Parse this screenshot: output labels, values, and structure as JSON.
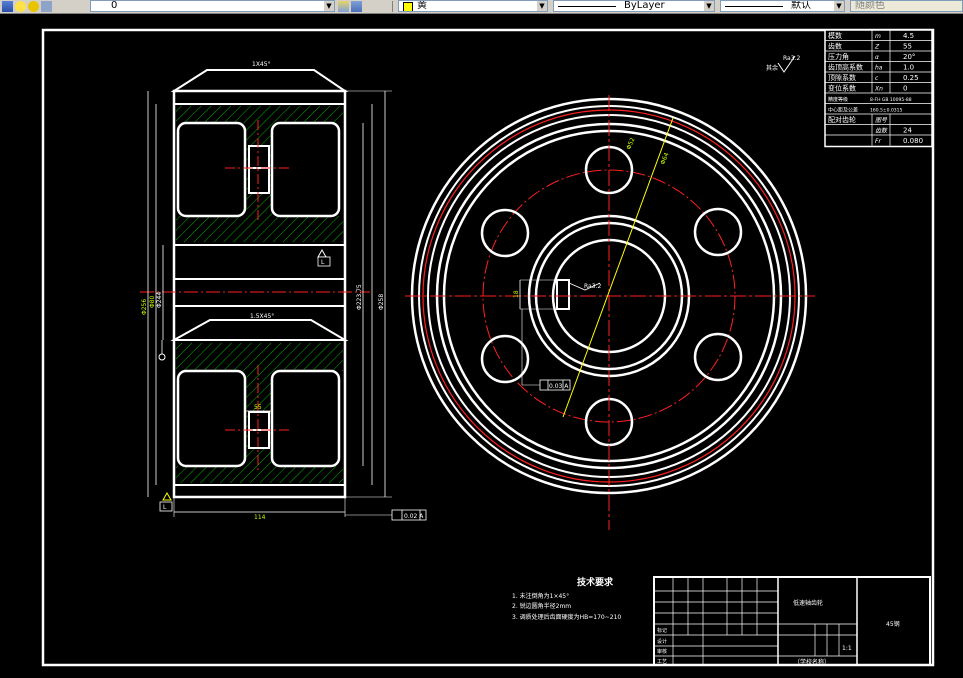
{
  "toolbar": {
    "layer_value": "0",
    "color_value": "黄",
    "linetype_value": "ByLayer",
    "lineweight_value": "默认",
    "plotstyle_value": "随颜色"
  },
  "drawing": {
    "section_top_label": "1X45°",
    "section_mid_label": "1.5X45°",
    "datum_label": "L",
    "roughness_label": "Ra3.2",
    "hub_width_label": "55",
    "bottom_width": "114",
    "tolerance_frame": "0.02 A",
    "keyway_dim": "18",
    "circle_dim_a": "Φ52",
    "circle_dim_b": "Φ64",
    "runout_frame": "0.03 A",
    "surface_mark": "其余",
    "left_dims": [
      "Φ256",
      "Φ80",
      "Φ244",
      "Φ240"
    ],
    "right_dims": [
      "Φ223.75",
      "Φ258"
    ]
  },
  "gear_table": {
    "rows": [
      {
        "label": "模数",
        "symbol": "m",
        "value": "4.5"
      },
      {
        "label": "齿数",
        "symbol": "Z",
        "value": "55"
      },
      {
        "label": "压力角",
        "symbol": "α",
        "value": "20°"
      },
      {
        "label": "齿顶高系数",
        "symbol": "ha",
        "value": "1.0"
      },
      {
        "label": "顶隙系数",
        "symbol": "c",
        "value": "0.25"
      },
      {
        "label": "变位系数",
        "symbol": "Xn",
        "value": "0"
      },
      {
        "label": "精度等级",
        "symbol": "",
        "value": "8-FH GB 10095-88"
      },
      {
        "label": "中心距及公差",
        "symbol": "",
        "value": "160.5±0.0315"
      },
      {
        "label": "配对齿轮",
        "symbol": "图号",
        "value": ""
      },
      {
        "label": "",
        "symbol": "齿数",
        "value": "24"
      },
      {
        "label": "",
        "symbol": "Fr",
        "value": "0.080"
      }
    ]
  },
  "tech_req": {
    "title": "技术要求",
    "items": [
      "1.  未注倒角为1×45°",
      "2.  锐边圆角半径2mm",
      "3.  调质处理后齿面硬度为HB=170~210"
    ]
  },
  "title_block": {
    "part_name": "低速轴齿轮",
    "material": "45钢",
    "scale": "1:1",
    "company": "（学校名称）",
    "roles": [
      "标记",
      "设计",
      "审核",
      "工艺"
    ]
  }
}
